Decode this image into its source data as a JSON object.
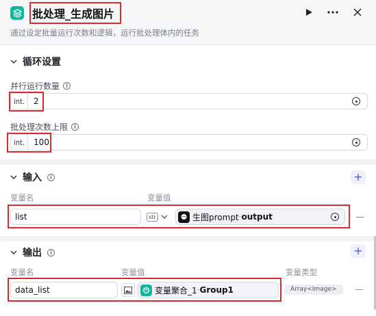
{
  "header": {
    "title": "批处理_生成图片",
    "description": "通过设定批量运行次数和逻辑，运行批处理体内的任务",
    "icons": {
      "node": "layers-icon",
      "run": "play-icon",
      "more": "more-icon",
      "close": "close-icon"
    },
    "accent_color": "#13b79c"
  },
  "loop_settings": {
    "title": "循环设置",
    "parallel": {
      "label": "并行运行数量",
      "type_prefix": "int.",
      "value": "2"
    },
    "max_batch": {
      "label": "批处理次数上限",
      "type_prefix": "int.",
      "value": "100"
    }
  },
  "inputs": {
    "title": "输入",
    "col_name": "变量名",
    "col_value": "变量值",
    "rows": [
      {
        "name": "list",
        "type_tag": "str",
        "ref_node": "生图prompt",
        "ref_sep": " · ",
        "ref_field": "output"
      }
    ]
  },
  "outputs": {
    "title": "输出",
    "col_name": "变量名",
    "col_value": "变量值",
    "col_type": "变量类型",
    "rows": [
      {
        "name": "data_list",
        "ref_node": "变量聚合_1",
        "ref_sep": " · ",
        "ref_field": "Group1",
        "var_type": "Array<Image>"
      }
    ]
  },
  "colors": {
    "highlight": "#d62b2b",
    "add_button": "#4e5bd6"
  }
}
